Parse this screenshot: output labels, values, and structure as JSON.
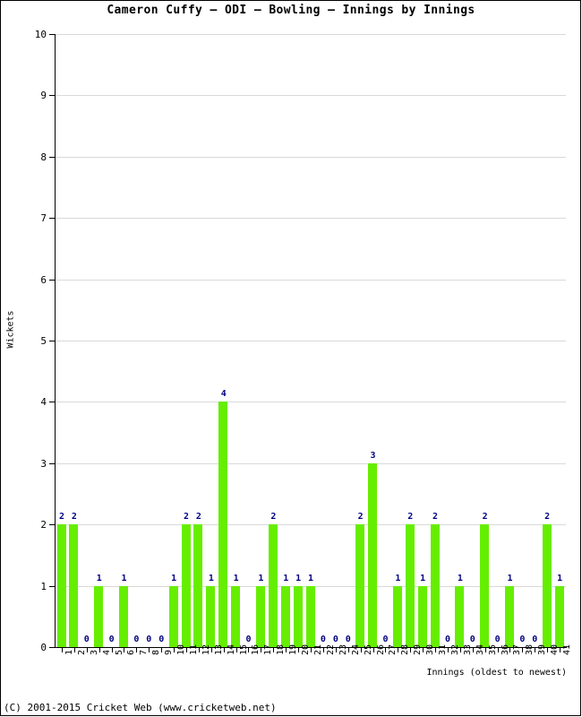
{
  "chart_data": {
    "type": "bar",
    "title": "Cameron Cuffy – ODI – Bowling – Innings by Innings",
    "xlabel": "Innings (oldest to newest)",
    "ylabel": "Wickets",
    "ylim": [
      0,
      10
    ],
    "ytick_values": [
      0,
      1,
      2,
      3,
      4,
      5,
      6,
      7,
      8,
      9,
      10
    ],
    "ytick_labels": [
      "0",
      "1",
      "2",
      "3",
      "4",
      "5",
      "6",
      "7",
      "8",
      "9",
      "10"
    ],
    "grid": true,
    "legend": "none",
    "bar_color": "#66ee00",
    "value_label_color": "#000080",
    "categories": [
      "1",
      "2",
      "3",
      "4",
      "5",
      "6",
      "7",
      "8",
      "9",
      "10",
      "11",
      "12",
      "13",
      "14",
      "15",
      "16",
      "17",
      "18",
      "19",
      "20",
      "21",
      "22",
      "23",
      "24",
      "25",
      "26",
      "27",
      "28",
      "29",
      "30",
      "31",
      "32",
      "33",
      "34",
      "35",
      "36",
      "37",
      "38",
      "39",
      "40",
      "41"
    ],
    "values": [
      2,
      2,
      0,
      1,
      0,
      1,
      0,
      0,
      0,
      1,
      2,
      2,
      1,
      4,
      1,
      0,
      1,
      2,
      1,
      1,
      1,
      0,
      0,
      0,
      2,
      3,
      0,
      1,
      2,
      1,
      2,
      0,
      1,
      0,
      2,
      0,
      1,
      0,
      0,
      2,
      1
    ]
  },
  "footer": {
    "copyright": "(C) 2001-2015 Cricket Web (www.cricketweb.net)"
  }
}
